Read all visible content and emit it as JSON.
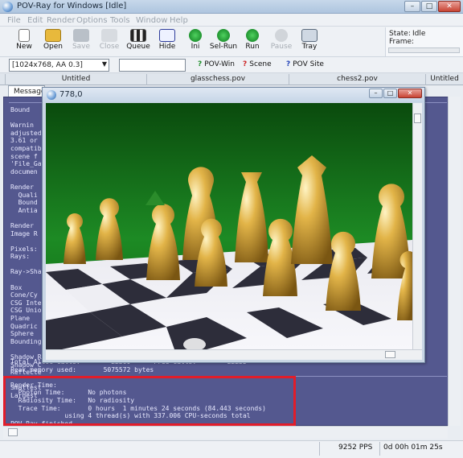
{
  "window": {
    "title": "POV-Ray for Windows [Idle]",
    "min_glyph": "–",
    "max_glyph": "□",
    "close_glyph": "✕"
  },
  "menu": [
    "File",
    "Edit",
    "Render",
    "Options",
    "Tools",
    "Window",
    "Help"
  ],
  "toolbar": [
    {
      "label": "New",
      "icon": "new-file-icon",
      "enabled": true
    },
    {
      "label": "Open",
      "icon": "open-folder-icon",
      "enabled": true
    },
    {
      "label": "Save",
      "icon": "save-icon",
      "enabled": false
    },
    {
      "label": "Close",
      "icon": "close-file-icon",
      "enabled": false
    },
    {
      "label": "Queue",
      "icon": "queue-icon",
      "enabled": true
    },
    {
      "label": "Hide",
      "icon": "hide-icon",
      "enabled": true
    },
    {
      "label": "Ini",
      "icon": "ini-icon",
      "enabled": true
    },
    {
      "label": "Sel-Run",
      "icon": "sel-run-icon",
      "enabled": true
    },
    {
      "label": "Run",
      "icon": "run-icon",
      "enabled": true
    },
    {
      "label": "Pause",
      "icon": "pause-icon",
      "enabled": false
    },
    {
      "label": "Tray",
      "icon": "tray-icon",
      "enabled": true
    }
  ],
  "status_panel": {
    "state_label": "State:",
    "state_value": "Idle",
    "frame_label": "Frame:"
  },
  "resolution": {
    "selected": "[1024x768, AA 0.3]"
  },
  "help_links": [
    {
      "label": "POV-Win",
      "icon": "help-povwin-icon"
    },
    {
      "label": "Scene",
      "icon": "help-scene-icon"
    },
    {
      "label": "POV Site",
      "icon": "help-povsite-icon"
    }
  ],
  "tabs": [
    "Untitled",
    "glasschess.pov",
    "chess2.pov",
    "Untitled"
  ],
  "messages_tab": "Message",
  "messages_left": [
    "Bound",
    "",
    "Warnin",
    "adjusted",
    "3.61 or",
    "compatib",
    "scene f",
    "'File_Ga",
    "documen",
    "",
    "Render ",
    "  Quali",
    "  Bound",
    "  Antia",
    "",
    "Render ",
    "Image R",
    "",
    "Pixels:",
    "Rays:",
    "",
    "Ray->Sha",
    "",
    "Box",
    "Cone/Cy",
    "CSG Inte",
    "CSG Unio",
    "Plane",
    "Quadric",
    "Sphere",
    "Bounding",
    "",
    "Shadow R",
    "Shadow C",
    "Reflecte",
    "",
    "Smallest",
    "Largest"
  ],
  "messages_bottom": [
    "Total Alloc Calls:        22360      Free Calls:        22255",
    "Peak memory used:       5075572 bytes",
    "",
    "Render Time:",
    "  Photon Time:      No photons",
    "  Radiosity Time:   No radiosity",
    "  Trace Time:       0 hours  1 minutes 24 seconds (84.443 seconds)",
    "              using 4 thread(s) with 337.006 CPU-seconds total",
    "POV-Ray finished"
  ],
  "render_window": {
    "title": "778,0"
  },
  "statusbar": {
    "pps": "9252 PPS",
    "elapsed": "0d 00h 01m 25s"
  },
  "colors": {
    "message_bg": "#54588f",
    "highlight": "#e11d2a",
    "board_green": "#0c6a14",
    "gold": "#d6a93a"
  }
}
